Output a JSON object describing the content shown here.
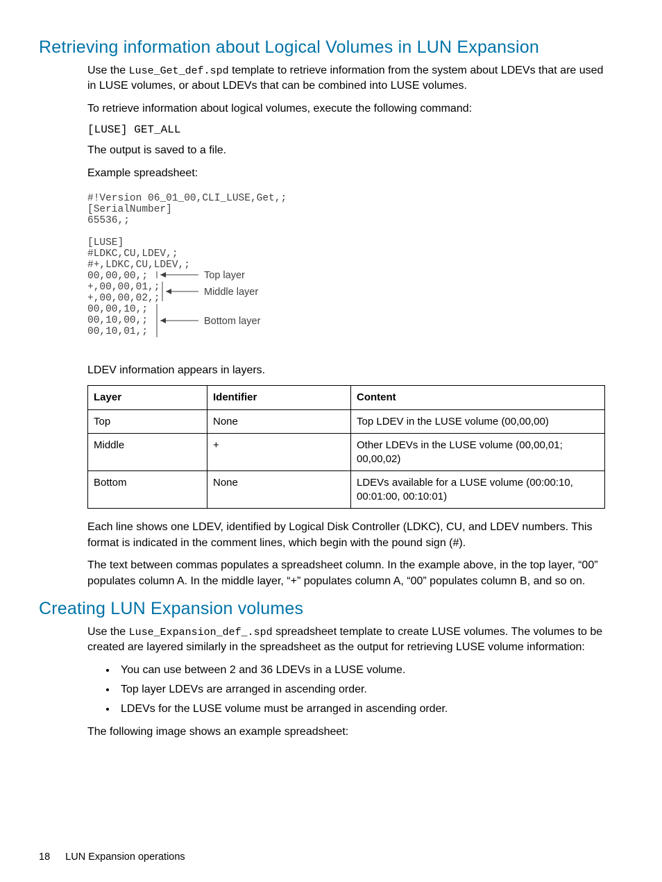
{
  "section1": {
    "title": "Retrieving information about Logical Volumes in LUN Expansion",
    "p1_a": "Use the ",
    "p1_code": "Luse_Get_def.spd",
    "p1_b": " template to retrieve information from the system about LDEVs that are used in LUSE volumes, or about LDEVs that can be combined into LUSE volumes.",
    "p2": "To retrieve information about logical volumes, execute the following command:",
    "cmd": "[LUSE] GET_ALL",
    "p3": "The output is saved to a file.",
    "p4": "Example spreadsheet:",
    "diagram": {
      "lines": [
        "#!Version 06_01_00,CLI_LUSE,Get,;",
        "[SerialNumber]",
        "65536,;",
        "",
        "[LUSE]",
        "#LDKC,CU,LDEV,;",
        "#+,LDKC,CU,LDEV,;",
        "00,00,00,;",
        "+,00,00,01,;",
        "+,00,00,02,;",
        "00,00,10,;",
        "00,10,00,;",
        "00,10,01,;"
      ],
      "labels": {
        "top": "Top layer",
        "middle": "Middle layer",
        "bottom": "Bottom layer"
      }
    },
    "after_diagram": "LDEV information appears in layers.",
    "table": {
      "headers": [
        "Layer",
        "Identifier",
        "Content"
      ],
      "rows": [
        [
          "Top",
          "None",
          "Top LDEV in the LUSE volume (00,00,00)"
        ],
        [
          "Middle",
          "+",
          "Other LDEVs in the LUSE volume (00,00,01; 00,00,02)"
        ],
        [
          "Bottom",
          "None",
          "LDEVs available for a LUSE volume (00:00:10, 00:01:00, 00:10:01)"
        ]
      ]
    },
    "p5": "Each line shows one LDEV, identified by Logical Disk Controller (LDKC), CU, and LDEV numbers. This format is indicated in the comment lines, which begin with the pound sign (#).",
    "p6": "The text between commas populates a spreadsheet column. In the example above, in the top layer, “00” populates column A. In the middle layer, “+” populates column A, “00” populates column B, and so on."
  },
  "section2": {
    "title": "Creating LUN Expansion volumes",
    "p1_a": "Use the ",
    "p1_code": "Luse_Expansion_def_.spd",
    "p1_b": " spreadsheet template to create LUSE volumes. The volumes to be created are layered similarly in the spreadsheet as the output for retrieving LUSE volume information:",
    "bullets": [
      "You can use between 2 and 36 LDEVs in a LUSE volume.",
      "Top layer LDEVs are arranged in ascending order.",
      "LDEVs for the LUSE volume must be arranged in ascending order."
    ],
    "p2": "The following image shows an example spreadsheet:"
  },
  "footer": {
    "page": "18",
    "chapter": "LUN Expansion operations"
  }
}
